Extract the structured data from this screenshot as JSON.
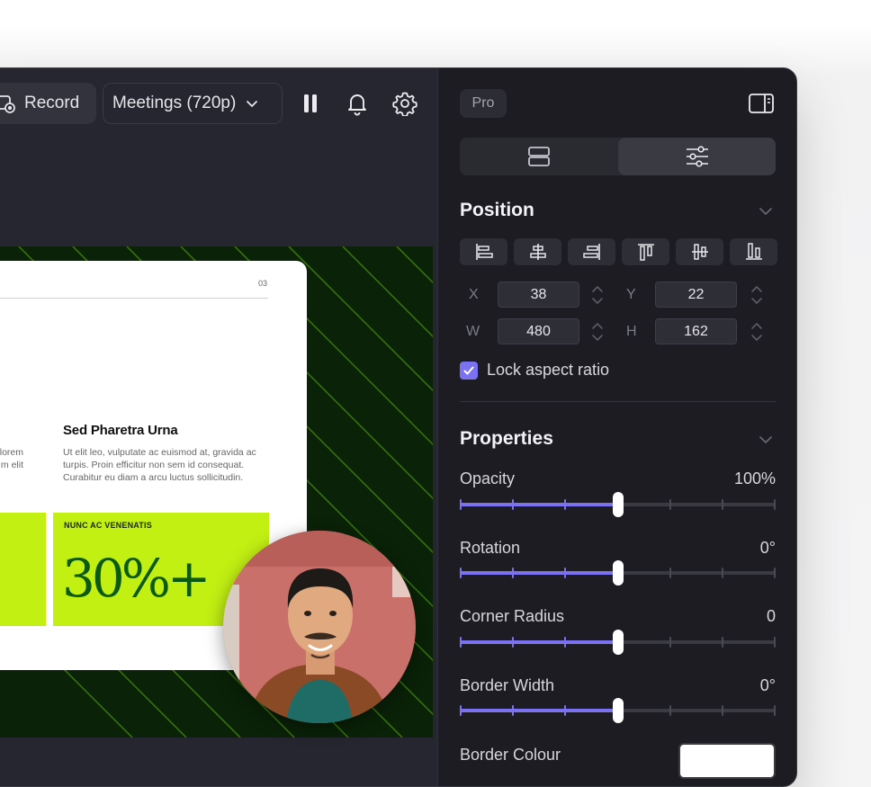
{
  "toolbar": {
    "record_label": "Record",
    "quality_value": "Meetings (720p)",
    "icons": [
      "record-icon",
      "chevron-down-icon",
      "pause-icon",
      "bell-icon",
      "gear-icon"
    ]
  },
  "slide": {
    "page_number": "03",
    "heading": "Sed Pharetra Urna",
    "body_left": "lorem\nm elit",
    "body": "Ut elit leo, vulputate ac euismod at, gravida ac turpis. Proin efficitur non sem id consequat. Curabitur eu diam a arcu luctus sollicitudin.",
    "stat_caption": "NUNC AC VENENATIS",
    "stat_value": "30%+",
    "colors": {
      "canvas_bg": "#0a2208",
      "stripe": "#3c7a10",
      "lime": "#c2f013",
      "stat_text": "#0b5a12"
    }
  },
  "panel": {
    "pro_badge": "Pro",
    "segments": [
      "layers-icon",
      "sliders-icon"
    ],
    "active_segment": 1,
    "position": {
      "title": "Position",
      "align_icons": [
        "align-left-icon",
        "align-center-h-icon",
        "align-right-icon",
        "align-top-icon",
        "align-center-v-icon",
        "align-bottom-icon"
      ],
      "x_label": "X",
      "x_value": "38",
      "y_label": "Y",
      "y_value": "22",
      "w_label": "W",
      "w_value": "480",
      "h_label": "H",
      "h_value": "162",
      "lock_label": "Lock aspect ratio",
      "lock_checked": true
    },
    "properties": {
      "title": "Properties",
      "sliders": [
        {
          "label": "Opacity",
          "value": "100%",
          "fraction": 0.5
        },
        {
          "label": "Rotation",
          "value": "0°",
          "fraction": 0.5
        },
        {
          "label": "Corner Radius",
          "value": "0",
          "fraction": 0.5
        },
        {
          "label": "Border Width",
          "value": "0°",
          "fraction": 0.5
        }
      ],
      "border_colour_label": "Border Colour",
      "border_colour_value": "#ffffff"
    },
    "accent": "#7a72f0"
  }
}
